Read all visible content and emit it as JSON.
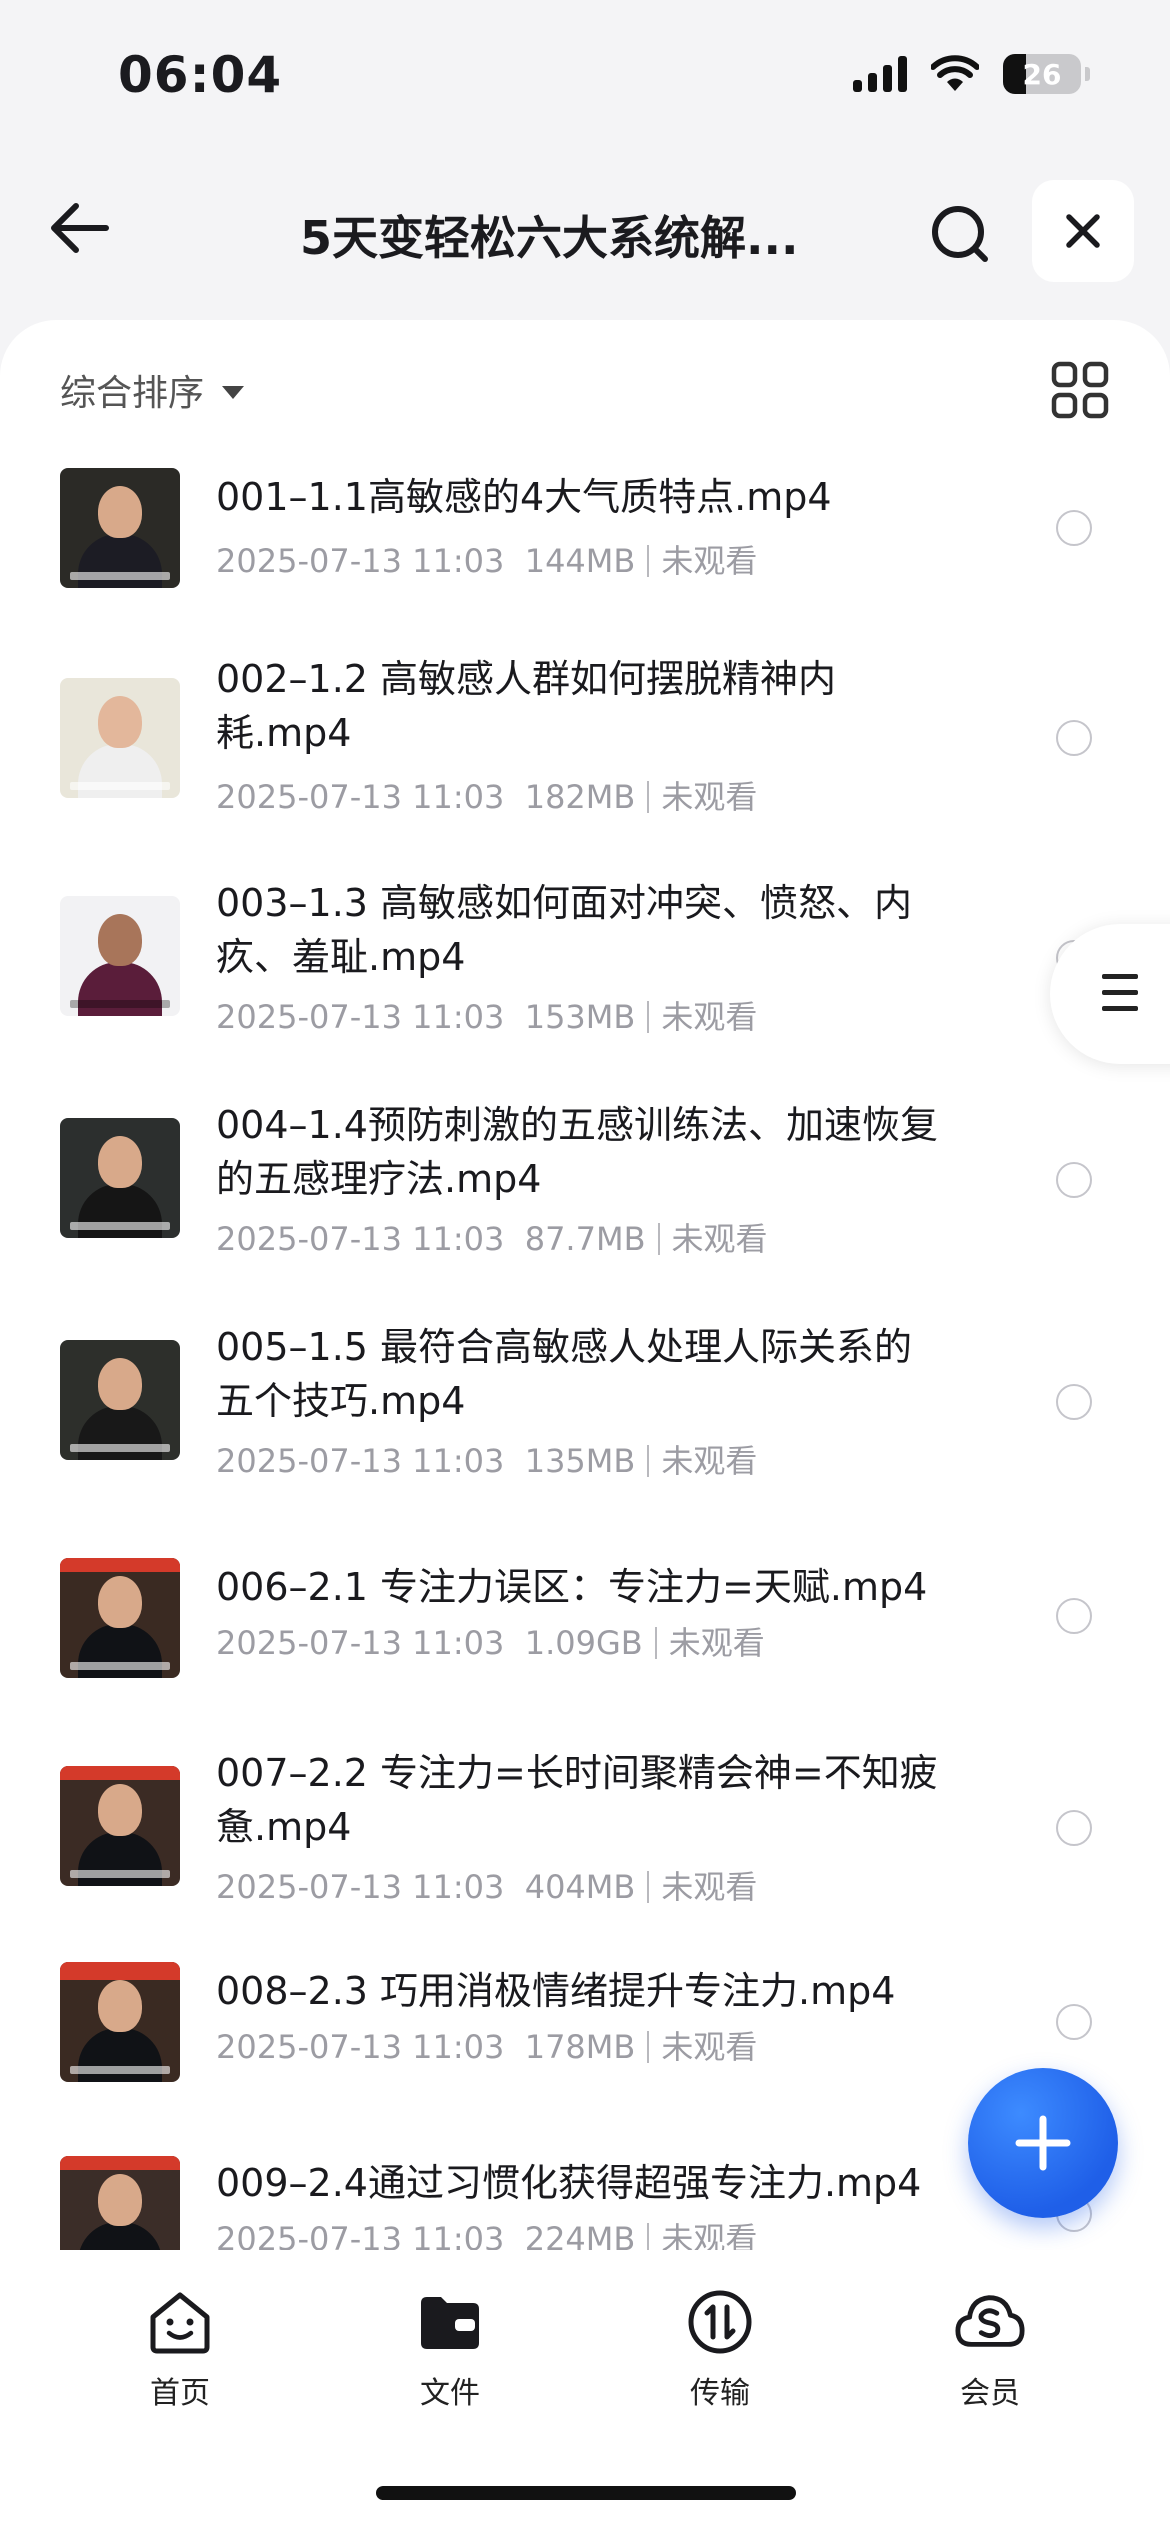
{
  "status": {
    "time": "06:04",
    "battery": "26"
  },
  "nav": {
    "title": "5天变轻松六大系统解..."
  },
  "sort": {
    "label": "综合排序"
  },
  "files": [
    {
      "name": "001–1.1高敏感的4大气质特点.mp4",
      "date": "2025-07-13 11:03",
      "size": "144MB",
      "status": "未观看"
    },
    {
      "name": "002–1.2  高敏感人群如何摆脱精神内耗.mp4",
      "date": "2025-07-13 11:03",
      "size": "182MB",
      "status": "未观看"
    },
    {
      "name": "003–1.3 高敏感如何面对冲突、愤怒、内疚、羞耻.mp4",
      "date": "2025-07-13 11:03",
      "size": "153MB",
      "status": "未观看"
    },
    {
      "name": "004–1.4预防刺激的五感训练法、加速恢复的五感理疗法.mp4",
      "date": "2025-07-13 11:03",
      "size": "87.7MB",
      "status": "未观看"
    },
    {
      "name": "005–1.5 最符合高敏感人处理人际关系的五个技巧.mp4",
      "date": "2025-07-13 11:03",
      "size": "135MB",
      "status": "未观看"
    },
    {
      "name": "006–2.1 专注力误区：专注力=天赋.mp4",
      "date": "2025-07-13 11:03",
      "size": "1.09GB",
      "status": "未观看"
    },
    {
      "name": "007–2.2 专注力=长时间聚精会神=不知疲惫.mp4",
      "date": "2025-07-13 11:03",
      "size": "404MB",
      "status": "未观看"
    },
    {
      "name": "008–2.3 巧用消极情绪提升专注力.mp4",
      "date": "2025-07-13 11:03",
      "size": "178MB",
      "status": "未观看"
    },
    {
      "name": "009–2.4通过习惯化获得超强专注力.mp4",
      "date": "2025-07-13 11:03",
      "size": "224MB",
      "status": "未观看"
    }
  ],
  "tabs": [
    {
      "label": "首页",
      "icon": "smiley-icon"
    },
    {
      "label": "文件",
      "icon": "folder-icon"
    },
    {
      "label": "传输",
      "icon": "transfer-icon"
    },
    {
      "label": "会员",
      "icon": "cloud-s-icon"
    }
  ]
}
